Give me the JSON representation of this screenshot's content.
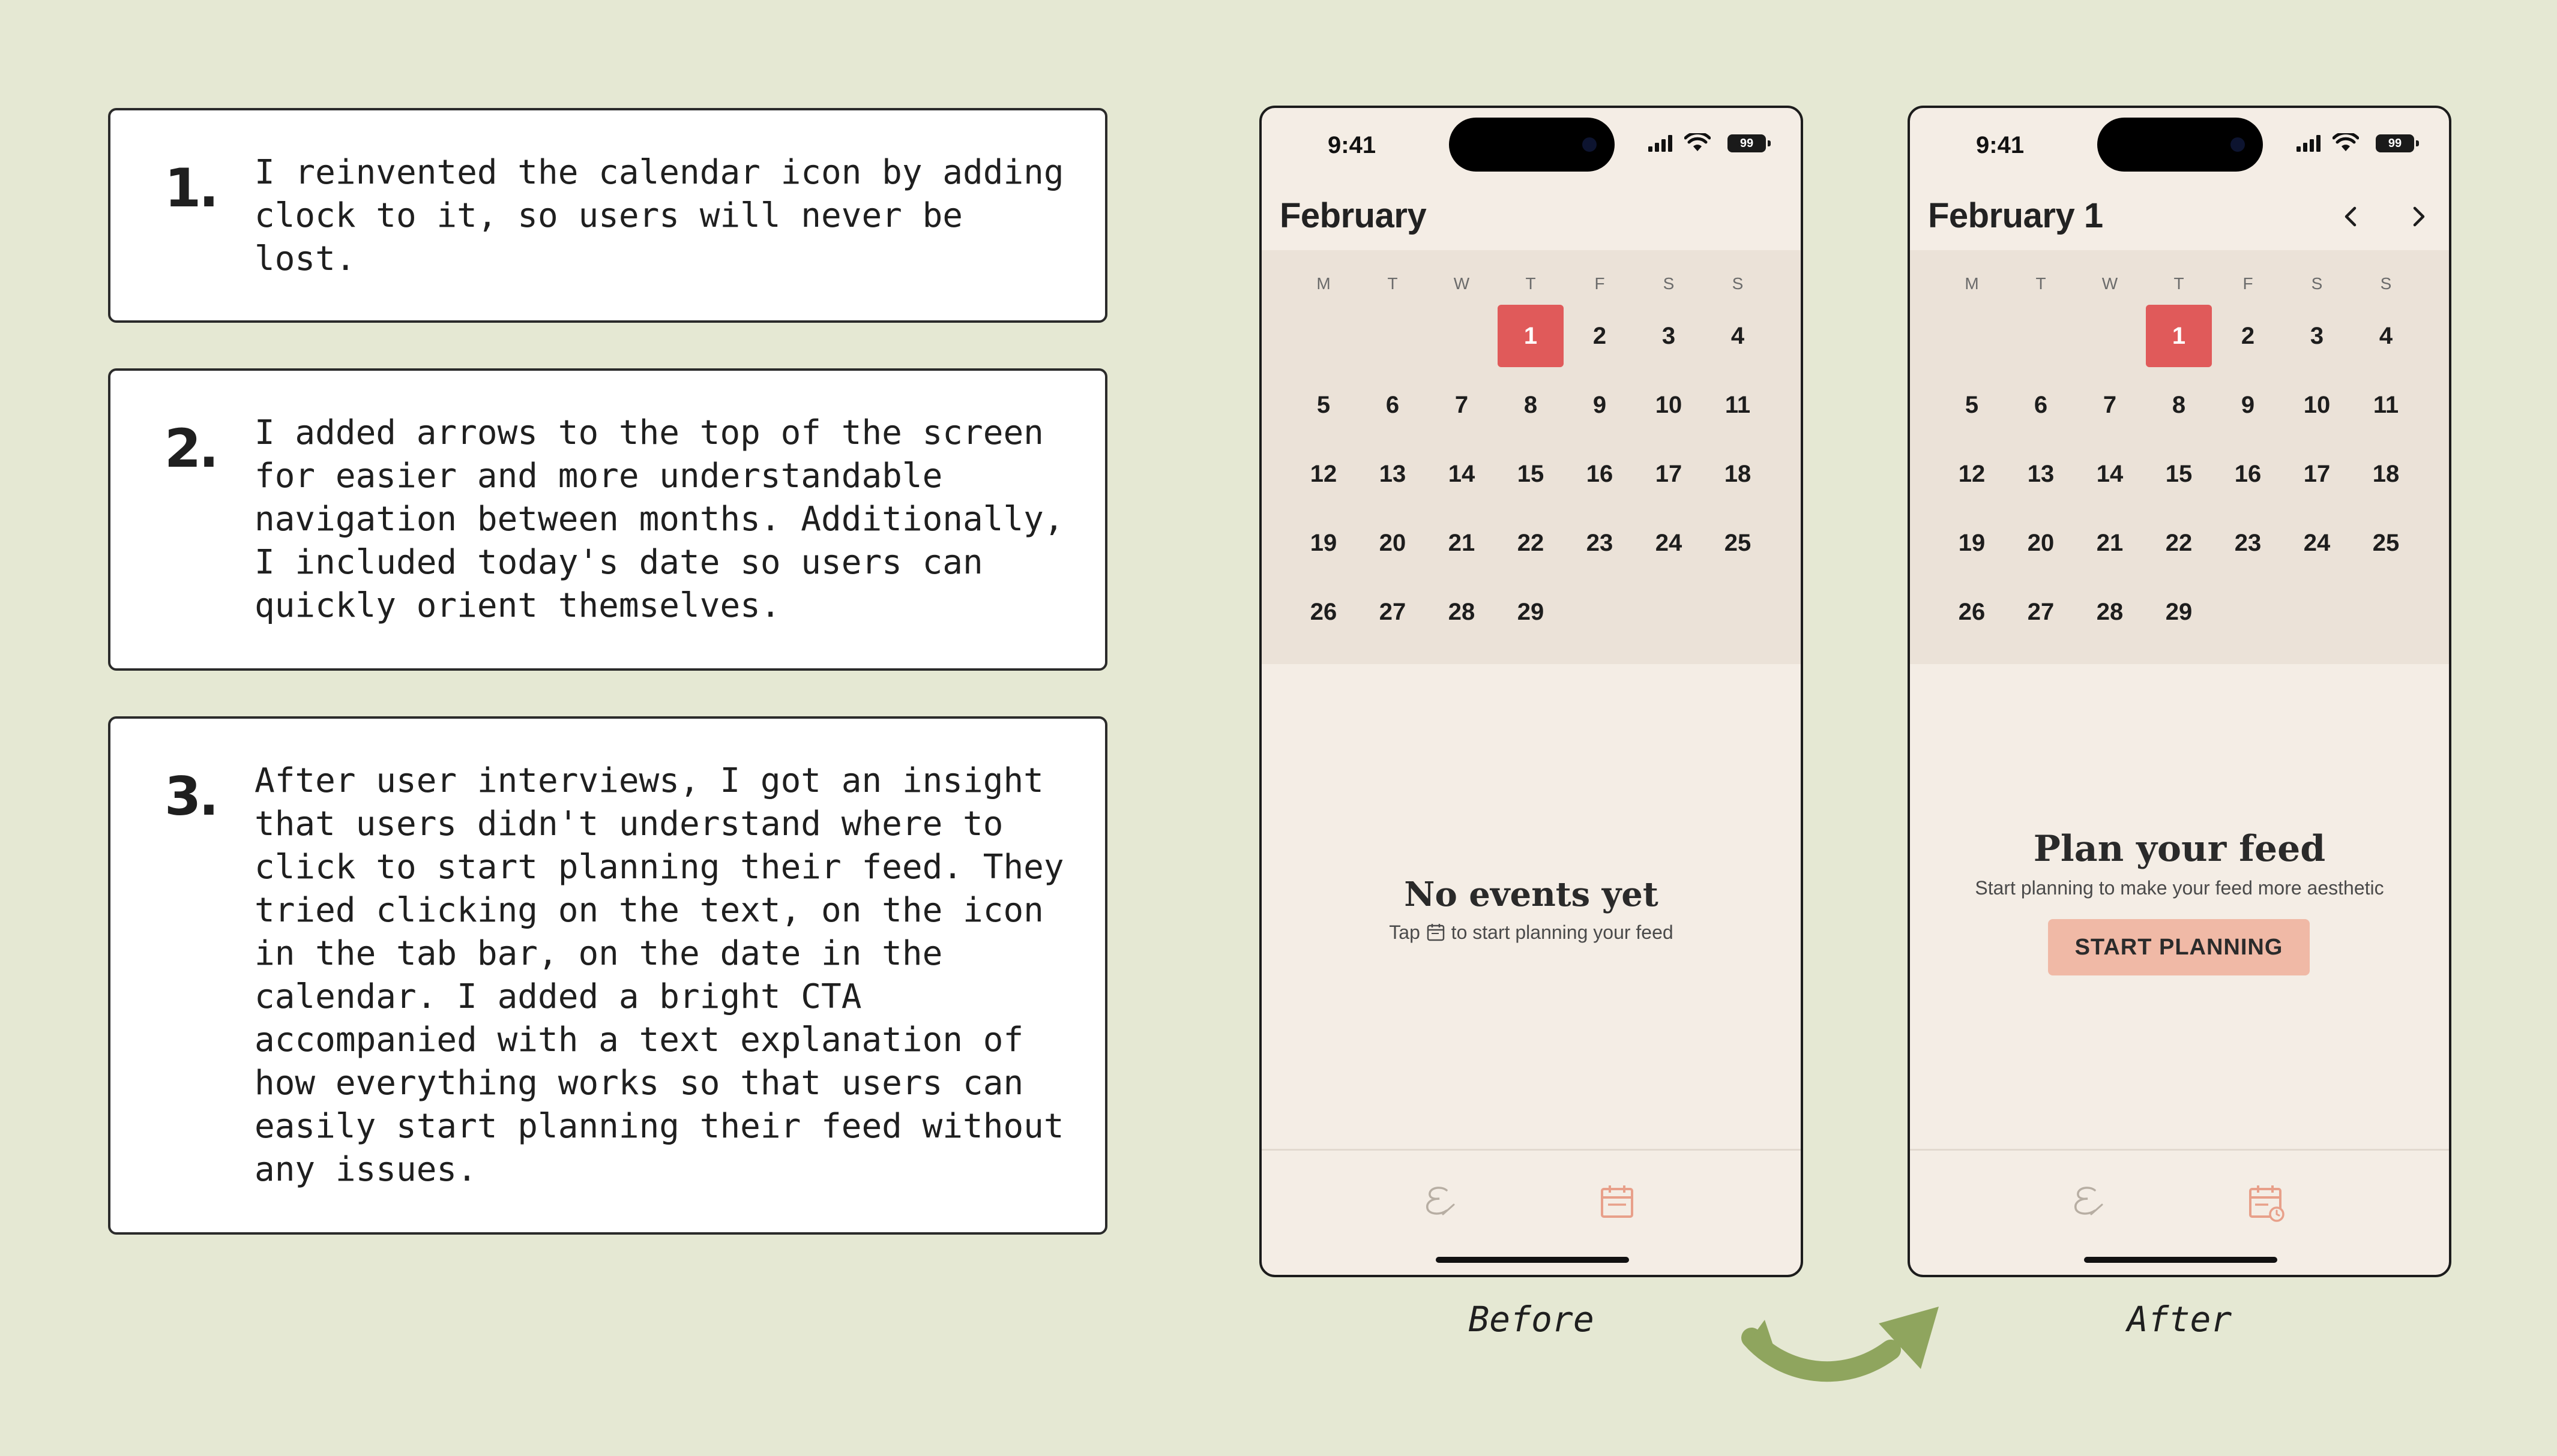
{
  "notes": [
    {
      "number": "1.",
      "text": "I reinvented the calendar icon by adding\nclock to it, so users will never be\nlost."
    },
    {
      "number": "2.",
      "text": "I added arrows to the top of the screen\nfor easier and more understandable\nnavigation between months. Additionally,\nI included today's date so users can\nquickly orient themselves."
    },
    {
      "number": "3.",
      "text": "After user interviews, I got an insight\nthat users didn't understand where to\nclick to start planning their feed. They\ntried clicking on the text, on the icon\nin the tab bar, on the date in the\ncalendar. I added a bright CTA\naccompanied with a text explanation of\nhow everything works so that users can\neasily start planning their feed without\nany issues."
    }
  ],
  "colors": {
    "background": "#e5e8d3",
    "today_highlight": "#e05a5a",
    "cta": "#f0b9a6",
    "calendar_bg": "#ebe2d8",
    "phone_bg": "#f4ede5",
    "arrow_green": "#8fa55e",
    "tab_accent": "#e8a08a"
  },
  "weekdays": [
    "M",
    "T",
    "W",
    "T",
    "F",
    "S",
    "S"
  ],
  "weeks": [
    [
      "",
      "",
      "",
      "1",
      "2",
      "3",
      "4"
    ],
    [
      "5",
      "6",
      "7",
      "8",
      "9",
      "10",
      "11"
    ],
    [
      "12",
      "13",
      "14",
      "15",
      "16",
      "17",
      "18"
    ],
    [
      "19",
      "20",
      "21",
      "22",
      "23",
      "24",
      "25"
    ],
    [
      "26",
      "27",
      "28",
      "29",
      "",
      "",
      ""
    ]
  ],
  "today": "1",
  "before": {
    "time": "9:41",
    "battery": "99",
    "month_title": "February",
    "empty_title": "No events yet",
    "empty_sub_prefix": "Tap",
    "empty_sub_suffix": "to start planning your feed",
    "caption": "Before",
    "tab_icons": [
      "script-e-icon",
      "calendar-icon"
    ]
  },
  "after": {
    "time": "9:41",
    "battery": "99",
    "month_title": "February 1",
    "prev_icon": "chevron-left-icon",
    "next_icon": "chevron-right-icon",
    "empty_title": "Plan your feed",
    "empty_sub": "Start planning to make your feed more aesthetic",
    "cta_label": "START PLANNING",
    "caption": "After",
    "tab_icons": [
      "script-e-icon",
      "calendar-clock-icon"
    ]
  },
  "transition_icon": "curved-arrow-icon"
}
